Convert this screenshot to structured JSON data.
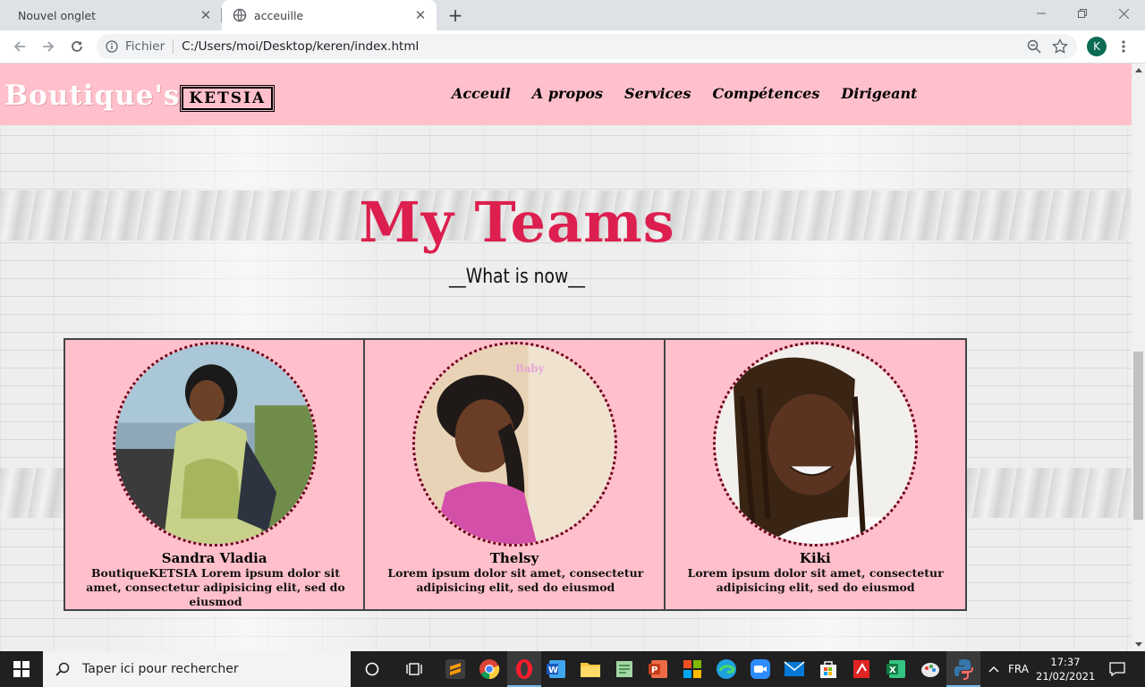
{
  "browser": {
    "tabs": [
      {
        "title": "Nouvel onglet",
        "active": false
      },
      {
        "title": "acceuille",
        "active": true
      }
    ],
    "url_scheme": "Fichier",
    "url": "C:/Users/moi/Desktop/keren/index.html",
    "profile_initial": "K"
  },
  "site": {
    "brand_name": "Boutique's",
    "brand_badge": "KETSIA",
    "nav": [
      "Acceuil",
      "A propos",
      "Services",
      "Compétences",
      "Dirigeant"
    ],
    "section_title": "My Teams",
    "section_subtitle": "__What is now__",
    "members": [
      {
        "name": "Sandra Vladia",
        "description": "BoutiqueKETSIA Lorem ipsum dolor sit amet, consectetur adipisicing elit, sed do eiusmod"
      },
      {
        "name": "Thelsy",
        "description": "Lorem ipsum dolor sit amet, consectetur adipisicing elit, sed do eiusmod",
        "photo_watermark": "Baby"
      },
      {
        "name": "Kiki",
        "description": "Lorem ipsum dolor sit amet, consectetur adipisicing elit, sed do eiusmod"
      }
    ],
    "colors": {
      "header_bg": "#ffc0cb",
      "title": "#dc1f4e",
      "photo_border": "#6b0018"
    }
  },
  "taskbar": {
    "search_placeholder": "Taper ici pour rechercher",
    "language": "FRA",
    "time": "17:37",
    "date": "21/02/2021",
    "apps": [
      "task-view-icon",
      "sublime-text-icon",
      "chrome-icon",
      "opera-icon",
      "word-icon",
      "file-explorer-icon",
      "notepad-plus-icon",
      "powerpoint-icon",
      "store-tiles-icon",
      "edge-icon",
      "zoom-icon",
      "mail-icon",
      "ms-store-icon",
      "pdf-icon",
      "excel-icon",
      "paint-icon",
      "python-icon"
    ]
  }
}
